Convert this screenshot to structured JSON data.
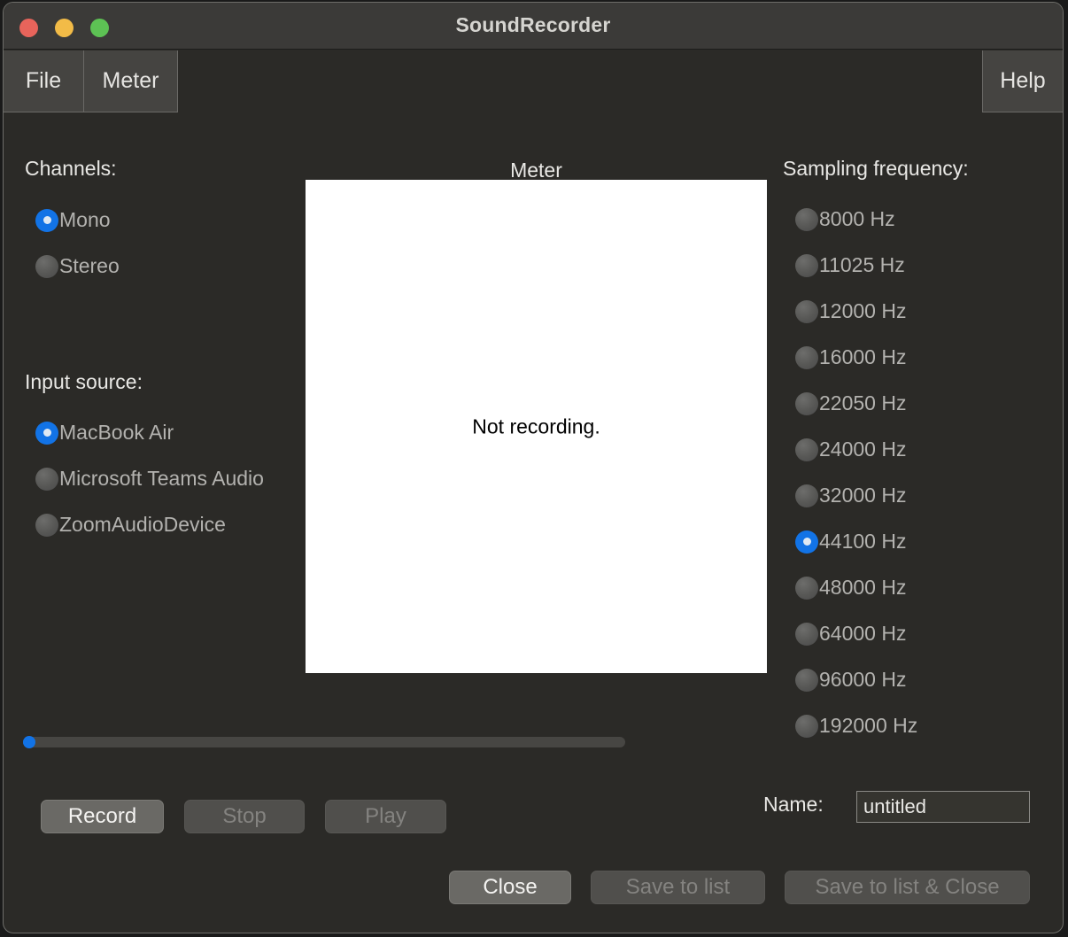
{
  "window": {
    "title": "SoundRecorder",
    "traffic_lights": {
      "close": "#e8645b",
      "minimize": "#f2bb47",
      "maximize": "#5dc254"
    }
  },
  "menubar": {
    "file": "File",
    "meter": "Meter",
    "help": "Help"
  },
  "channels": {
    "label": "Channels:",
    "options": [
      {
        "label": "Mono",
        "checked": true
      },
      {
        "label": "Stereo",
        "checked": false
      }
    ]
  },
  "input_source": {
    "label": "Input source:",
    "options": [
      {
        "label": "MacBook Air",
        "checked": true
      },
      {
        "label": "Microsoft Teams Audio",
        "checked": false
      },
      {
        "label": "ZoomAudioDevice",
        "checked": false
      }
    ]
  },
  "sampling_frequency": {
    "label": "Sampling frequency:",
    "options": [
      {
        "label": "8000 Hz",
        "checked": false
      },
      {
        "label": "11025 Hz",
        "checked": false
      },
      {
        "label": "12000 Hz",
        "checked": false
      },
      {
        "label": "16000 Hz",
        "checked": false
      },
      {
        "label": "22050 Hz",
        "checked": false
      },
      {
        "label": "24000 Hz",
        "checked": false
      },
      {
        "label": "32000 Hz",
        "checked": false
      },
      {
        "label": "44100 Hz",
        "checked": true
      },
      {
        "label": "48000 Hz",
        "checked": false
      },
      {
        "label": "64000 Hz",
        "checked": false
      },
      {
        "label": "96000 Hz",
        "checked": false
      },
      {
        "label": "192000 Hz",
        "checked": false
      }
    ]
  },
  "meter": {
    "title": "Meter",
    "status": "Not recording.",
    "background": "#ffffff"
  },
  "slider": {
    "value": 0,
    "min": 0,
    "max": 100,
    "accent": "#1273e6"
  },
  "transport": {
    "record": {
      "label": "Record",
      "enabled": true
    },
    "stop": {
      "label": "Stop",
      "enabled": false
    },
    "play": {
      "label": "Play",
      "enabled": false
    }
  },
  "name_field": {
    "label": "Name:",
    "value": "untitled",
    "placeholder": "untitled"
  },
  "footer": {
    "close": {
      "label": "Close",
      "enabled": true
    },
    "save_to_list": {
      "label": "Save to list",
      "enabled": false
    },
    "save_to_list_and_close": {
      "label": "Save to list & Close",
      "enabled": false
    }
  },
  "colors": {
    "accent": "#1273e6",
    "window_bg": "#2b2a27",
    "titlebar_bg": "#3b3a38",
    "text": "#e9e8e5",
    "muted_text": "#b3b2af"
  }
}
